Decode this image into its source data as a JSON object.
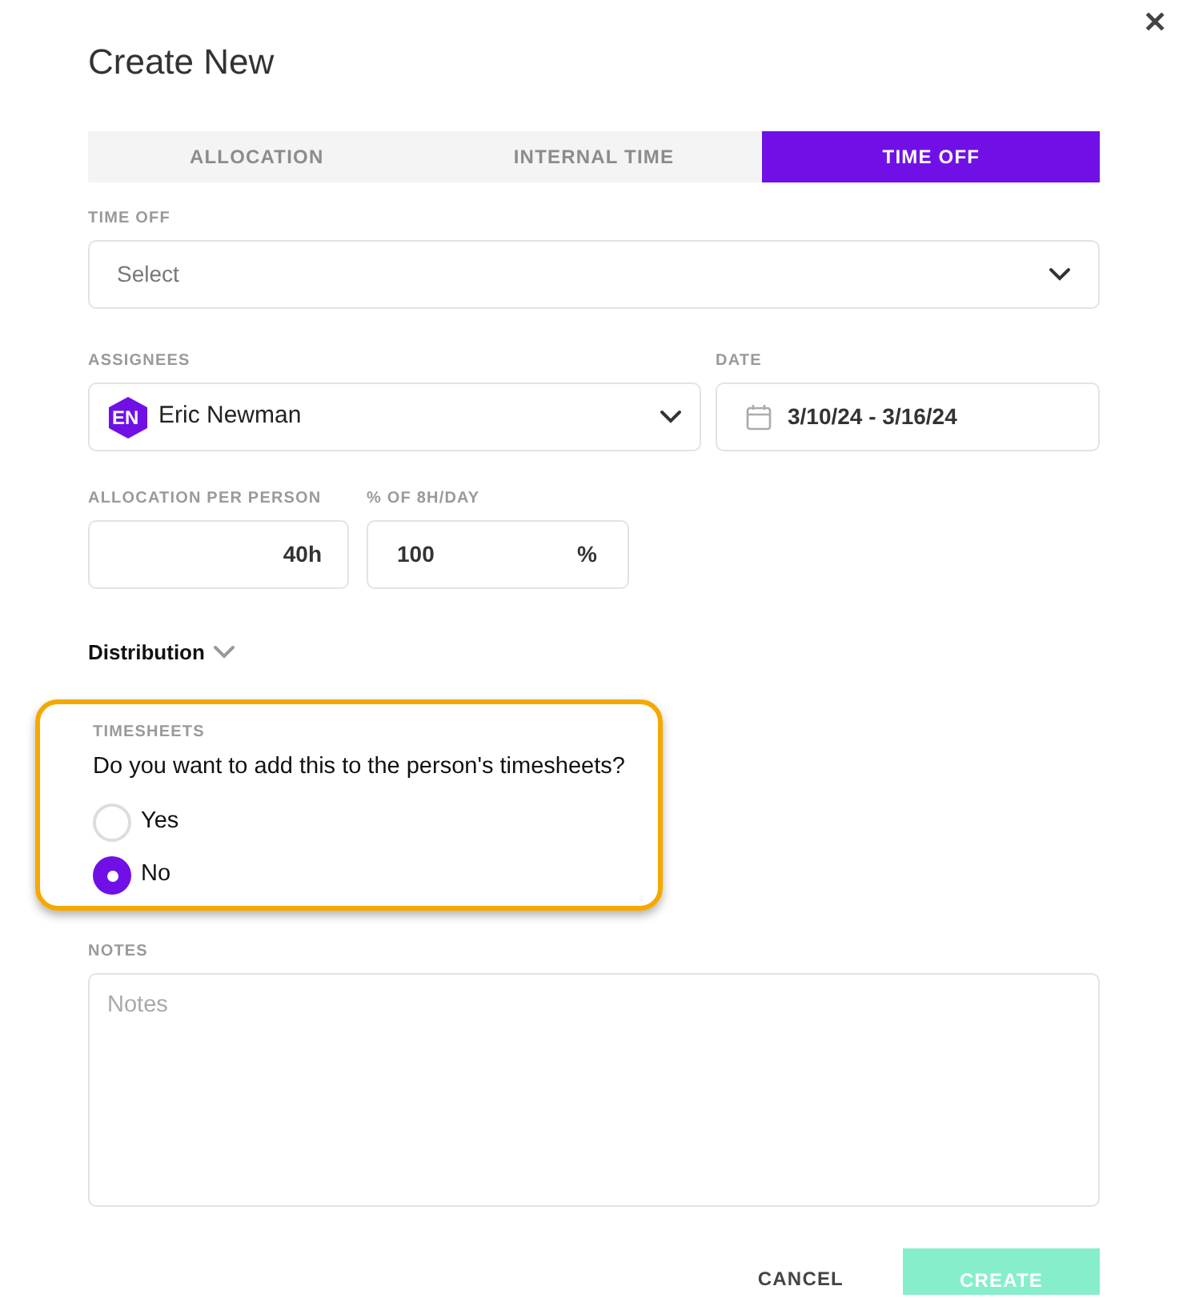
{
  "dialog": {
    "title": "Create New",
    "close": "✕"
  },
  "tabs": [
    {
      "label": "ALLOCATION",
      "selected": false
    },
    {
      "label": "INTERNAL TIME",
      "selected": false
    },
    {
      "label": "TIME OFF",
      "selected": true
    }
  ],
  "time_off": {
    "label": "TIME OFF",
    "placeholder": "Select"
  },
  "assignees": {
    "label": "ASSIGNEES",
    "initials": "EN",
    "value": "Eric Newman"
  },
  "date": {
    "label": "DATE",
    "value": "3/10/24 - 3/16/24"
  },
  "allocation": {
    "label": "ALLOCATION PER PERSON",
    "value": "40h"
  },
  "percent": {
    "label": "% OF 8H/DAY",
    "value": "100",
    "unit": "%"
  },
  "distribution": {
    "label": "Distribution",
    "expanded": false
  },
  "timesheets": {
    "highlighted": true,
    "label": "TIMESHEETS",
    "question": "Do you want to add this to the person's timesheets?",
    "options": [
      {
        "label": "Yes",
        "selected": false
      },
      {
        "label": "No",
        "selected": true
      }
    ]
  },
  "notes": {
    "label": "NOTES",
    "placeholder": "Notes"
  },
  "buttons": {
    "cancel": "CANCEL",
    "create": "CREATE",
    "create_disabled": true
  }
}
